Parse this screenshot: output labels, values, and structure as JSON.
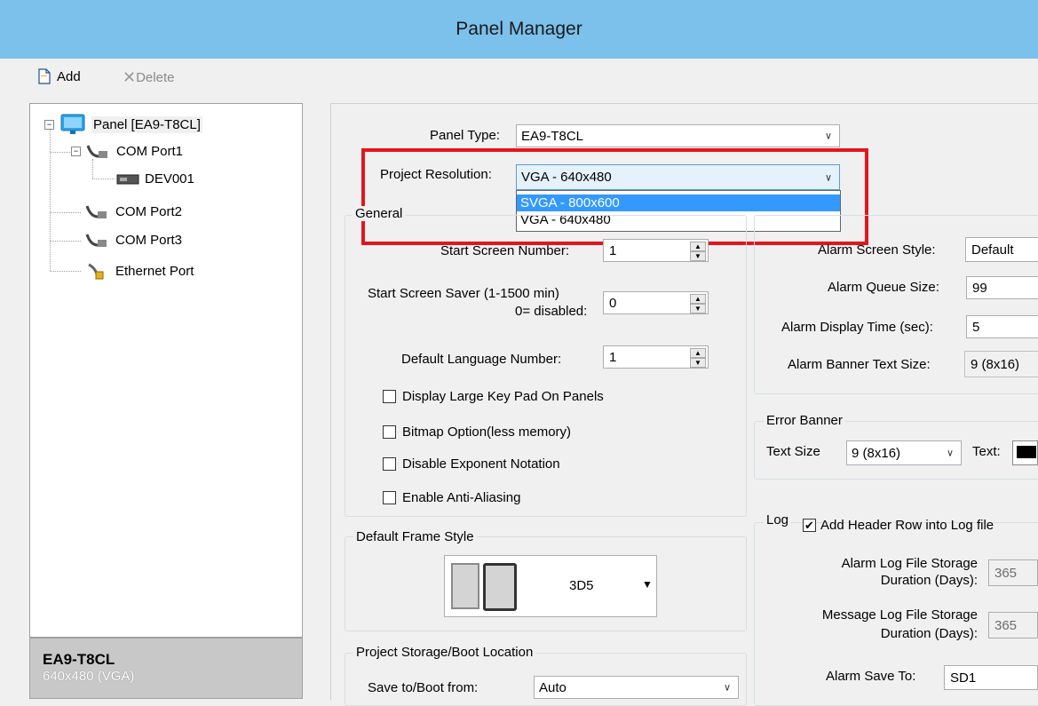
{
  "window": {
    "title": "Panel Manager"
  },
  "toolbar": {
    "add_label": "Add",
    "delete_label": "Delete"
  },
  "tree": {
    "root": "Panel [EA9-T8CL]",
    "com1": "COM Port1",
    "dev": "DEV001",
    "com2": "COM Port2",
    "com3": "COM Port3",
    "eth": "Ethernet Port"
  },
  "panel_info": {
    "model": "EA9-T8CL",
    "resolution": "640x480 (VGA)"
  },
  "panel_type": {
    "label": "Panel Type:",
    "value": "EA9-T8CL"
  },
  "project_resolution": {
    "label": "Project Resolution:",
    "value": "VGA - 640x480",
    "options": [
      "SVGA - 800x600",
      "VGA - 640x480"
    ],
    "highlighted_option": "SVGA - 800x600"
  },
  "general": {
    "title": "General",
    "start_screen_label": "Start Screen Number:",
    "start_screen_value": "1",
    "saver_label_1": "Start Screen Saver (1-1500 min)",
    "saver_label_2": "0= disabled:",
    "saver_value": "0",
    "lang_label": "Default Language Number:",
    "lang_value": "1",
    "checkboxes": [
      "Display Large Key Pad On Panels",
      "Bitmap Option(less memory)",
      "Disable Exponent Notation",
      "Enable Anti-Aliasing"
    ]
  },
  "frame_style": {
    "title": "Default Frame Style",
    "value": "3D5"
  },
  "storage": {
    "title": "Project Storage/Boot Location",
    "label": "Save to/Boot from:",
    "value": "Auto"
  },
  "alarm": {
    "style_label": "Alarm Screen Style:",
    "style_value": "Default",
    "queue_label": "Alarm Queue Size:",
    "queue_value": "99",
    "display_label": "Alarm Display Time (sec):",
    "display_value": "5",
    "banner_label": "Alarm Banner Text Size:",
    "banner_value": "9 (8x16)"
  },
  "error_banner": {
    "title": "Error Banner",
    "size_label": "Text Size",
    "size_value": "9 (8x16)",
    "text_label": "Text:"
  },
  "log": {
    "title": "Log",
    "header_row_label": "Add Header Row into Log file",
    "alarm_storage_1": "Alarm Log File Storage",
    "alarm_storage_2": "Duration (Days):",
    "alarm_storage_value": "365",
    "msg_storage_1": "Message Log File Storage",
    "msg_storage_2": "Duration (Days):",
    "msg_storage_value": "365",
    "alarm_save_label": "Alarm Save To:",
    "alarm_save_value": "SD1"
  },
  "colors": {
    "titlebar": "#7cc0ec",
    "highlight": "#e5151c",
    "selection": "#3399ff"
  }
}
